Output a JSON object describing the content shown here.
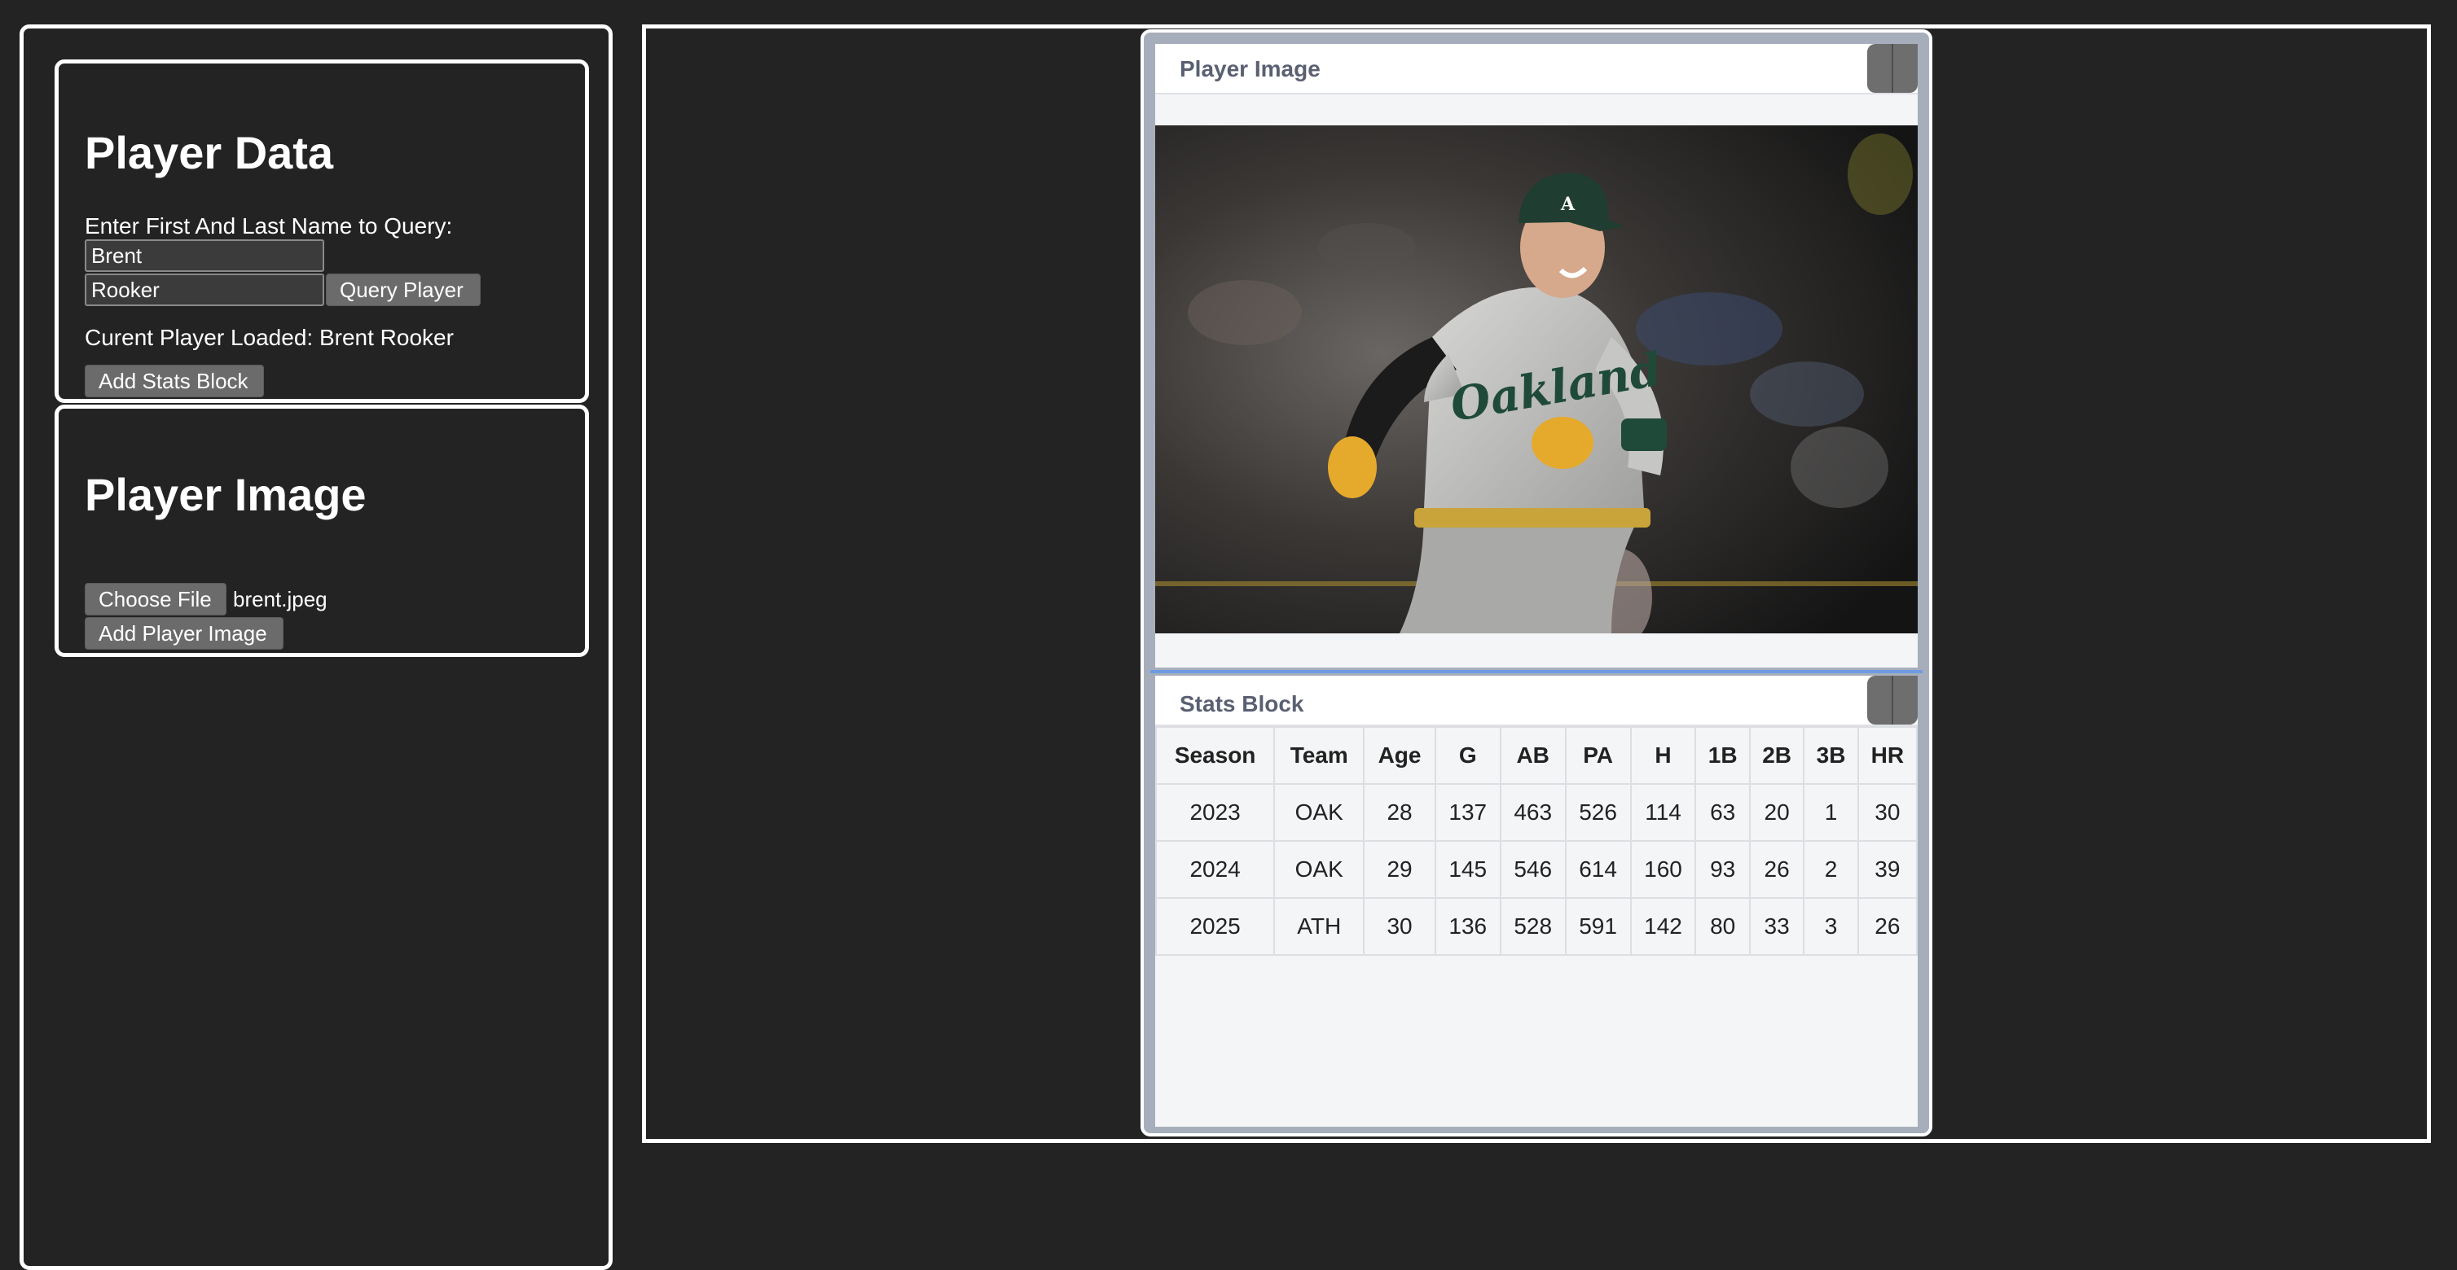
{
  "player_data_panel": {
    "title": "Player Data",
    "query_label": "Enter First And Last Name to Query:",
    "first_name_value": "Brent",
    "last_name_value": "Rooker",
    "query_button_label": "Query Player",
    "current_player_text": "Curent Player Loaded: Brent Rooker",
    "add_stats_button_label": "Add Stats Block"
  },
  "player_image_panel": {
    "title": "Player Image",
    "choose_file_label": "Choose File",
    "file_name": "brent.jpeg",
    "add_image_button_label": "Add Player Image"
  },
  "image_widget": {
    "title": "Player Image"
  },
  "stats_widget": {
    "title": "Stats Block",
    "columns": [
      "Season",
      "Team",
      "Age",
      "G",
      "AB",
      "PA",
      "H",
      "1B",
      "2B",
      "3B",
      "HR"
    ],
    "rows": [
      [
        "2023",
        "OAK",
        "28",
        "137",
        "463",
        "526",
        "114",
        "63",
        "20",
        "1",
        "30"
      ],
      [
        "2024",
        "OAK",
        "29",
        "145",
        "546",
        "614",
        "160",
        "93",
        "26",
        "2",
        "39"
      ],
      [
        "2025",
        "ATH",
        "30",
        "136",
        "528",
        "591",
        "142",
        "80",
        "33",
        "3",
        "26"
      ]
    ]
  },
  "colors": {
    "background": "#232323",
    "panel_border": "#ffffff",
    "button": "#6b6b6b",
    "widget_frame": "#a7aebb",
    "widget_body": "#f4f5f7",
    "divider": "#6f9be3"
  }
}
